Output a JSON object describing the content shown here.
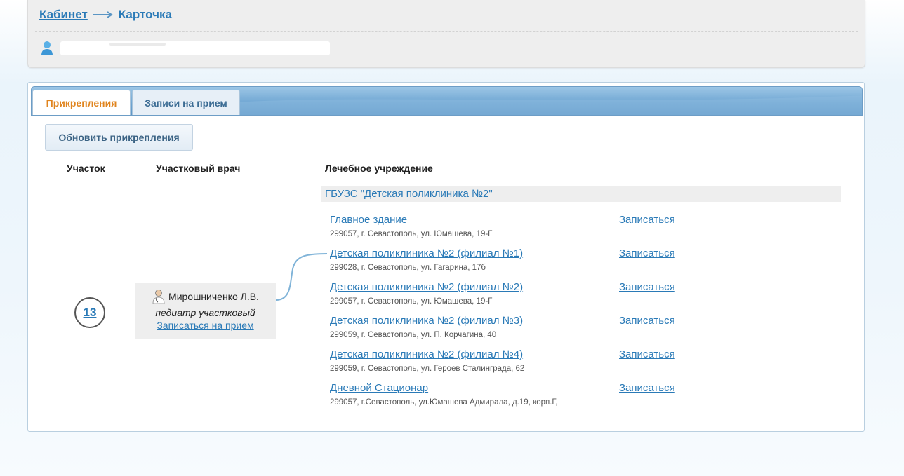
{
  "breadcrumb": {
    "first": "Кабинет",
    "second": "Карточка"
  },
  "user": {
    "icon": "user-icon",
    "name_redacted": true
  },
  "tabs": [
    {
      "label": "Прикрепления",
      "active": true
    },
    {
      "label": "Записи на прием",
      "active": false
    }
  ],
  "refresh_button": "Обновить прикрепления",
  "columns": {
    "district": "Участок",
    "doctor": "Участковый врач",
    "institution": "Лечебное учреждение"
  },
  "district_number": "13",
  "doctor": {
    "name": "Мирошниченко Л.В.",
    "specialty": "педиатр участковый",
    "signup_link": "Записаться на прием"
  },
  "institution": {
    "name": "ГБУЗС \"Детская поликлиника №2\"",
    "branches": [
      {
        "name": "Главное здание",
        "address": "299057, г. Севастополь, ул. Юмашева, 19-Г",
        "action": "Записаться"
      },
      {
        "name": "Детская поликлиника №2 (филиал №1)",
        "address": "299028, г. Севастополь, ул. Гагарина, 17б",
        "action": "Записаться"
      },
      {
        "name": "Детская поликлиника №2 (филиал №2)",
        "address": "299057, г. Севастополь, ул. Юмашева, 19-Г",
        "action": "Записаться"
      },
      {
        "name": "Детская поликлиника №2 (филиал №3)",
        "address": "299059, г. Севастополь, ул. П. Корчагина, 40",
        "action": "Записаться"
      },
      {
        "name": "Детская поликлиника №2 (филиал №4)",
        "address": "299059, г. Севастополь, ул. Героев Сталинграда, 62",
        "action": "Записаться"
      },
      {
        "name": "Дневной Стационар",
        "address": "299057, г.Севастополь, ул.Юмашева Адмирала, д.19, корп.Г,",
        "action": "Записаться"
      }
    ]
  },
  "colors": {
    "link": "#2a7ab7",
    "active_tab": "#e0841e",
    "tabbar": "#6ea5d2"
  }
}
